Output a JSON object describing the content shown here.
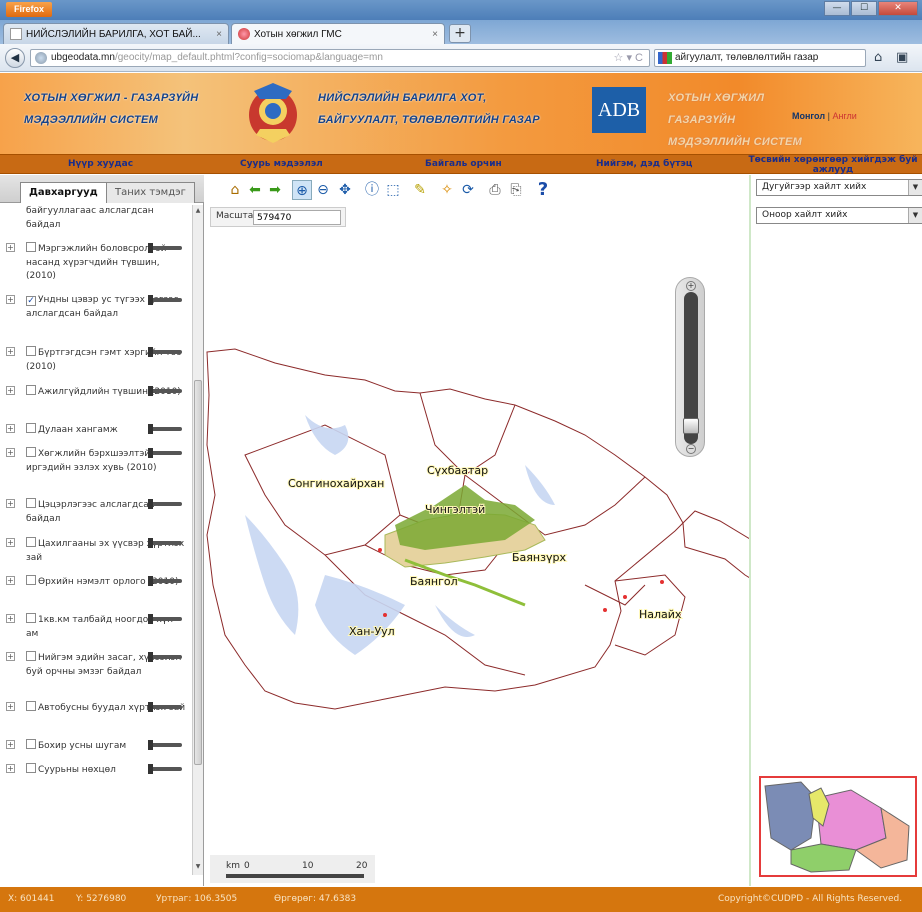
{
  "browser": {
    "app_button": "Firefox",
    "tabs": [
      {
        "label": "НИЙСЛЭЛИЙН БАРИЛГА, ХОТ БАЙ..."
      },
      {
        "label": "Хотын хөгжил ГМС"
      }
    ],
    "url_host": "ubgeodata.mn",
    "url_path": "/geocity/map_default.phtml?config=sociomap&language=mn",
    "search_text": "айгуулалт, төлөвлөлтийн газар"
  },
  "header": {
    "title_left_1": "ХОТЫН ХӨГЖИЛ - ГАЗАРЗҮЙН",
    "title_left_2": "МЭДЭЭЛЛИЙН СИСТЕМ",
    "title_center_1": "НИЙСЛЭЛИЙН БАРИЛГА ХОТ,",
    "title_center_2": "БАЙГУУЛАЛТ, ТӨЛӨВЛӨЛТИЙН ГАЗАР",
    "logo_text": "ADB",
    "title_right_1": "ХОТЫН ХӨГЖИЛ ГАЗАРЗҮЙН",
    "title_right_2": "МЭДЭЭЛЛИЙН СИСТЕМ",
    "lang_mn": "Монгол",
    "lang_sep": "|",
    "lang_en": "Англи"
  },
  "menu": [
    "Нүүр хуудас",
    "Суурь мэдээлэл",
    "Байгаль орчин",
    "Нийгэм, дэд бүтэц",
    "Төсвийн хөрөнгөөр хийгдэж буй ажлууд"
  ],
  "left_tabs": [
    "Давхаргууд",
    "Таних тэмдэг"
  ],
  "layers": [
    {
      "label": "байгууллагаас алслагдсан байдал",
      "checked": false,
      "expandable": false,
      "cb": false
    },
    {
      "label": "Мэргэжлийн боловсролтой насанд хүрэгчдийн түвшин, (2010)",
      "checked": false
    },
    {
      "label": "Ундны цэвэр ус түгээх цэгээс алслагдсан байдал",
      "checked": true
    },
    {
      "label": "Бүртгэгдсэн гэмт хэргийн тоо (2010)",
      "checked": false
    },
    {
      "label": "Ажилгүйдлийн түвшин (2010)",
      "checked": false
    },
    {
      "label": "Дулаан хангамж",
      "checked": false
    },
    {
      "label": "Хөгжлийн бэрхшээлтэй иргэдийн эзлэх хувь (2010)",
      "checked": false
    },
    {
      "label": "Цэцэрлэгээс алслагдсан байдал",
      "checked": false
    },
    {
      "label": "Цахилгааны эх үүсвэр хүртлэх зай",
      "checked": false
    },
    {
      "label": "Өрхийн нэмэлт орлого (2010)",
      "checked": false
    },
    {
      "label": "1кв.км талбайд ноогдох хүн ам",
      "checked": false
    },
    {
      "label": "Нийгэм эдийн засаг, хүрээлэн буй орчны эмзэг байдал",
      "checked": false
    },
    {
      "label": "Автобусны буудал хүртлэх зай",
      "checked": false
    },
    {
      "label": "Бохир усны шугам",
      "checked": false
    },
    {
      "label": "Суурьны нөхцөл",
      "checked": false
    }
  ],
  "scale": {
    "label": "Масштаб 1:",
    "value": "579470"
  },
  "map": {
    "labels": [
      "Сонгинохайрхан",
      "Сүхбаатар",
      "Чингэлтэй",
      "Баянзүрх",
      "Баянгол",
      "Налайх",
      "Хан-Уул"
    ],
    "scalebar_unit": "km",
    "scalebar_ticks": [
      "0",
      "10",
      "20"
    ]
  },
  "right": {
    "search_area": "Дугуйгээр хайлт хийх",
    "search_coord": "Оноор хайлт хийх"
  },
  "status": {
    "x": "X: 601441",
    "y": "Y: 5276980",
    "lon": "Уртраг: 106.3505",
    "lat": "Өргөрөг: 47.6383",
    "copyright": "Copyright©CUDPD - All Rights Reserved."
  },
  "icons": [
    "home-icon",
    "back-icon",
    "forward-icon",
    "zoom-in-icon",
    "zoom-out-icon",
    "pan-icon",
    "identify-icon",
    "select-icon",
    "measure-icon",
    "clear-icon",
    "refresh-icon",
    "print-icon",
    "export-icon",
    "help-icon"
  ]
}
